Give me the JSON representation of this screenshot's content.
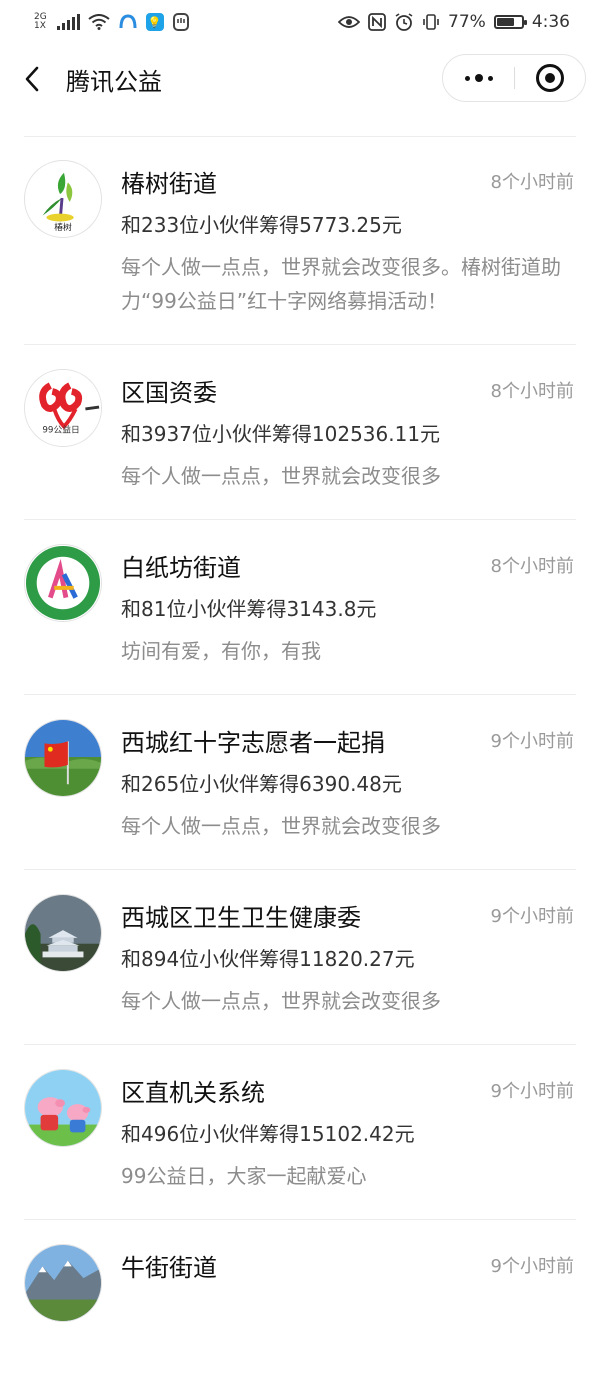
{
  "status_bar": {
    "network": "2G",
    "network_sub": "1X",
    "battery": "77%",
    "battery_level": 0.77,
    "time": "4:36"
  },
  "nav": {
    "title": "腾讯公益",
    "back_icon": "chevron-left-icon",
    "more_icon": "more-dots-icon",
    "close_icon": "target-close-icon"
  },
  "items": [
    {
      "name": "椿树街道",
      "time": "8个小时前",
      "raised": "和233位小伙伴筹得5773.25元",
      "desc": "每个人做一点点，世界就会改变很多。椿树街道助力“99公益日”红十字网络募捐活动！",
      "avatar_text": "椿树"
    },
    {
      "name": "区国资委",
      "time": "8个小时前",
      "raised": "和3937位小伙伴筹得102536.11元",
      "desc": "每个人做一点点，世界就会改变很多",
      "avatar_text": "99公益日"
    },
    {
      "name": "白纸坊街道",
      "time": "8个小时前",
      "raised": "和81位小伙伴筹得3143.8元",
      "desc": "坊间有爱，有你，有我",
      "avatar_text": ""
    },
    {
      "name": "西城红十字志愿者一起捐",
      "time": "9个小时前",
      "raised": "和265位小伙伴筹得6390.48元",
      "desc": "每个人做一点点，世界就会改变很多",
      "avatar_text": ""
    },
    {
      "name": "西城区卫生卫生健康委",
      "time": "9个小时前",
      "raised": "和894位小伙伴筹得11820.27元",
      "desc": "每个人做一点点，世界就会改变很多",
      "avatar_text": ""
    },
    {
      "name": "区直机关系统",
      "time": "9个小时前",
      "raised": "和496位小伙伴筹得15102.42元",
      "desc": "99公益日，大家一起献爱心",
      "avatar_text": ""
    },
    {
      "name": "牛街街道",
      "time": "9个小时前",
      "raised": "",
      "desc": "",
      "avatar_text": ""
    }
  ]
}
